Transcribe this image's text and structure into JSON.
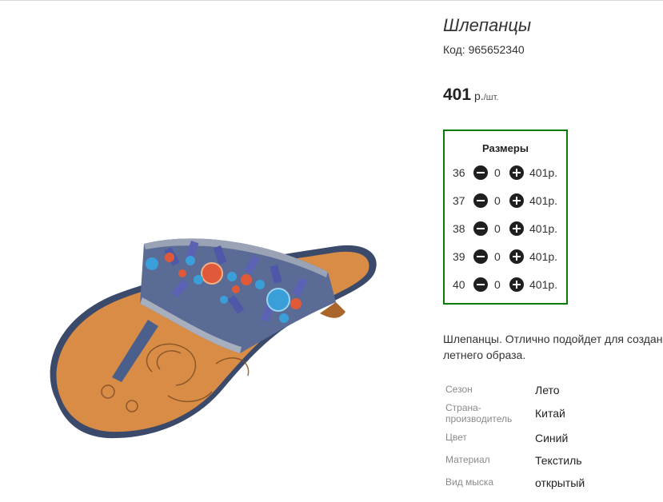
{
  "product": {
    "title": "Шлепанцы",
    "code": "Код: 965652340",
    "price_value": "401",
    "price_currency": "р.",
    "price_unit": "/шт.",
    "description_line1": "Шлепанцы. Отлично подойдет для создания",
    "description_line2": "летнего образа."
  },
  "sizes_panel": {
    "title": "Размеры",
    "border_color": "#0a7a0a",
    "rows": [
      {
        "size": "36",
        "qty": "0",
        "price": "401р."
      },
      {
        "size": "37",
        "qty": "0",
        "price": "401р."
      },
      {
        "size": "38",
        "qty": "0",
        "price": "401р."
      },
      {
        "size": "39",
        "qty": "0",
        "price": "401р."
      },
      {
        "size": "40",
        "qty": "0",
        "price": "401р."
      }
    ]
  },
  "attributes": [
    {
      "key": "Сезон",
      "value": "Лето"
    },
    {
      "key": "Страна-производитель",
      "value": "Китай"
    },
    {
      "key": "Цвет",
      "value": "Синий"
    },
    {
      "key": "Материал",
      "value": "Текстиль"
    },
    {
      "key": "Вид мыска",
      "value": "открытый"
    }
  ]
}
